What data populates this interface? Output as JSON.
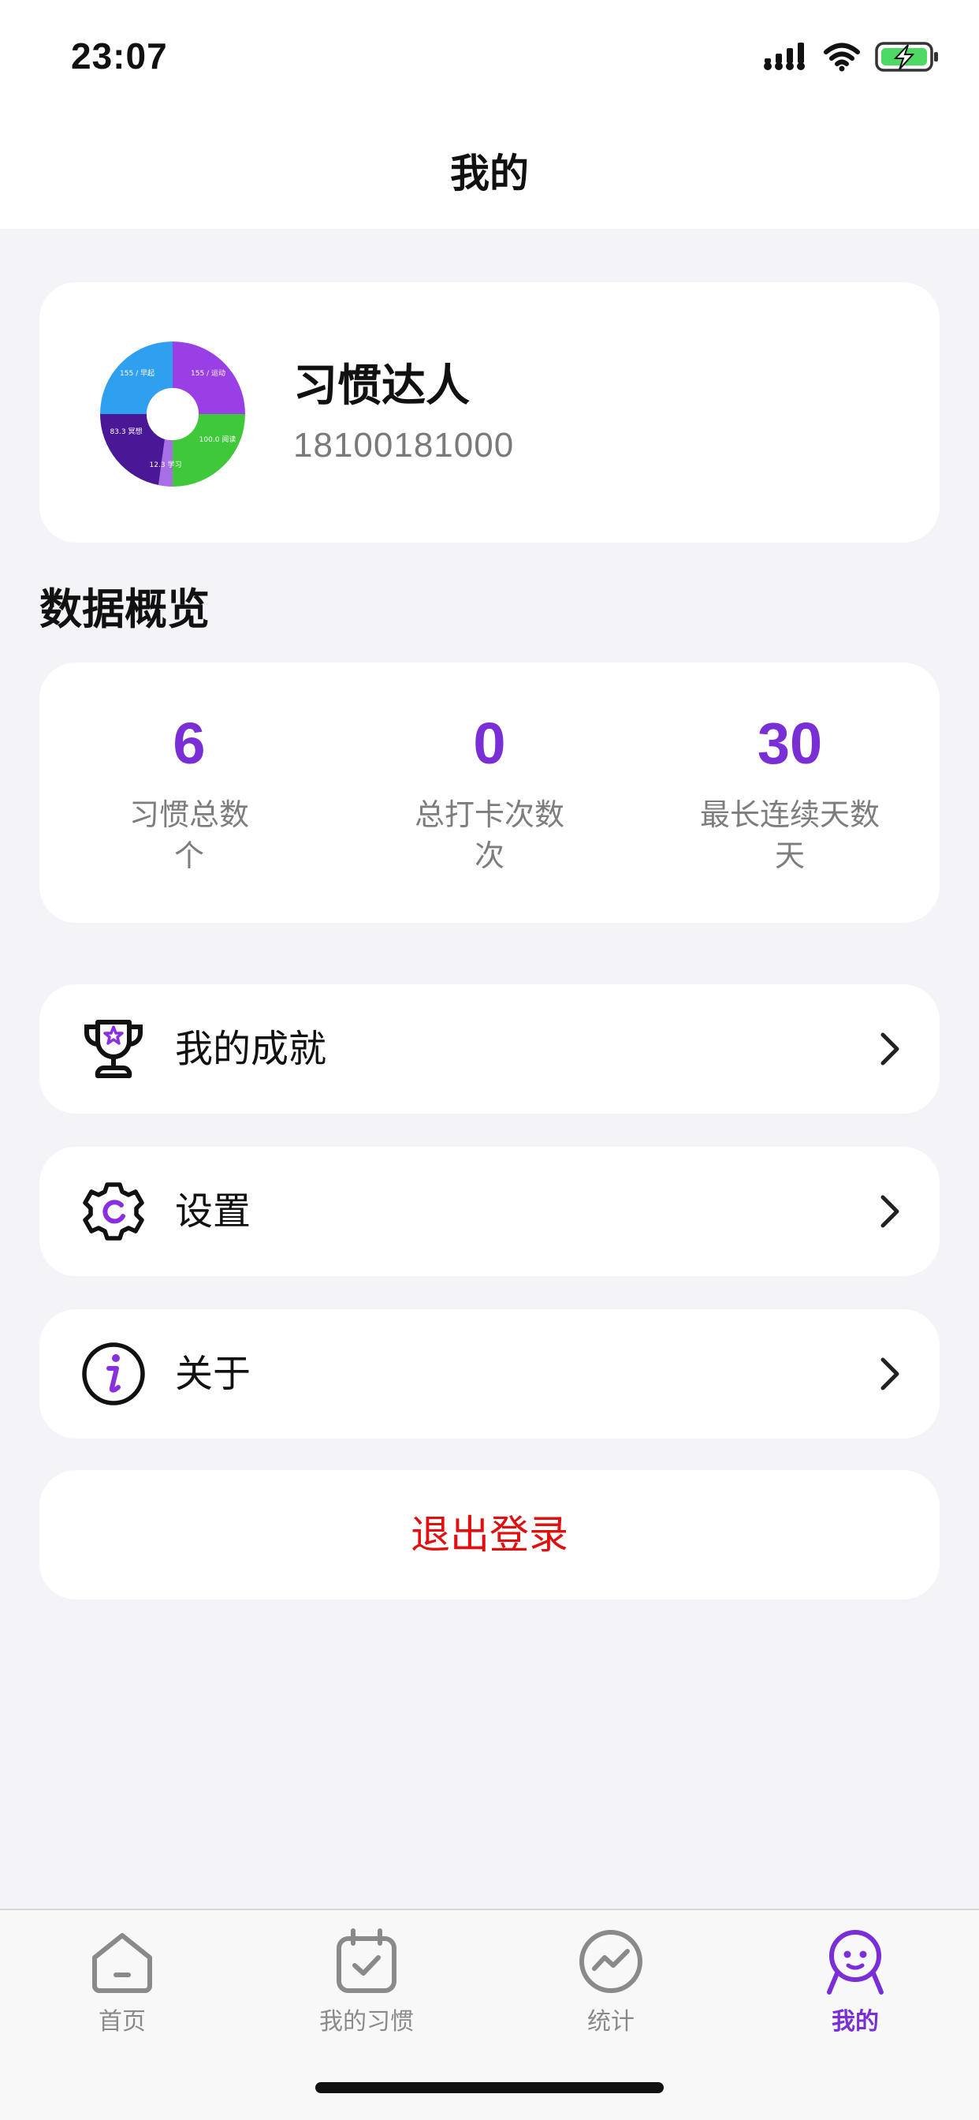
{
  "status_bar": {
    "time": "23:07",
    "icons": [
      "signal-icon",
      "wifi-icon",
      "battery-charging-icon"
    ]
  },
  "header": {
    "title": "我的"
  },
  "profile": {
    "name": "习惯达人",
    "phone": "18100181000",
    "avatar_labels": [
      "155 / 早起",
      "155 / 运动",
      "100.0 阅读",
      "12.3 学习",
      "83.3 冥想"
    ]
  },
  "overview": {
    "title": "数据概览",
    "stats": [
      {
        "value": "6",
        "label": "习惯总数",
        "unit": "个"
      },
      {
        "value": "0",
        "label": "总打卡次数",
        "unit": "次"
      },
      {
        "value": "30",
        "label": "最长连续天数",
        "unit": "天"
      }
    ]
  },
  "menu": [
    {
      "label": "我的成就",
      "icon": "trophy-icon"
    },
    {
      "label": "设置",
      "icon": "gear-icon"
    },
    {
      "label": "关于",
      "icon": "info-icon"
    }
  ],
  "logout": {
    "label": "退出登录"
  },
  "tabs": [
    {
      "label": "首页",
      "icon": "home-icon",
      "active": false
    },
    {
      "label": "我的习惯",
      "icon": "calendar-check-icon",
      "active": false
    },
    {
      "label": "统计",
      "icon": "chart-icon",
      "active": false
    },
    {
      "label": "我的",
      "icon": "profile-icon",
      "active": true
    }
  ],
  "colors": {
    "accent": "#7a2fd6",
    "danger": "#e01010",
    "background": "#f3f3f8"
  }
}
